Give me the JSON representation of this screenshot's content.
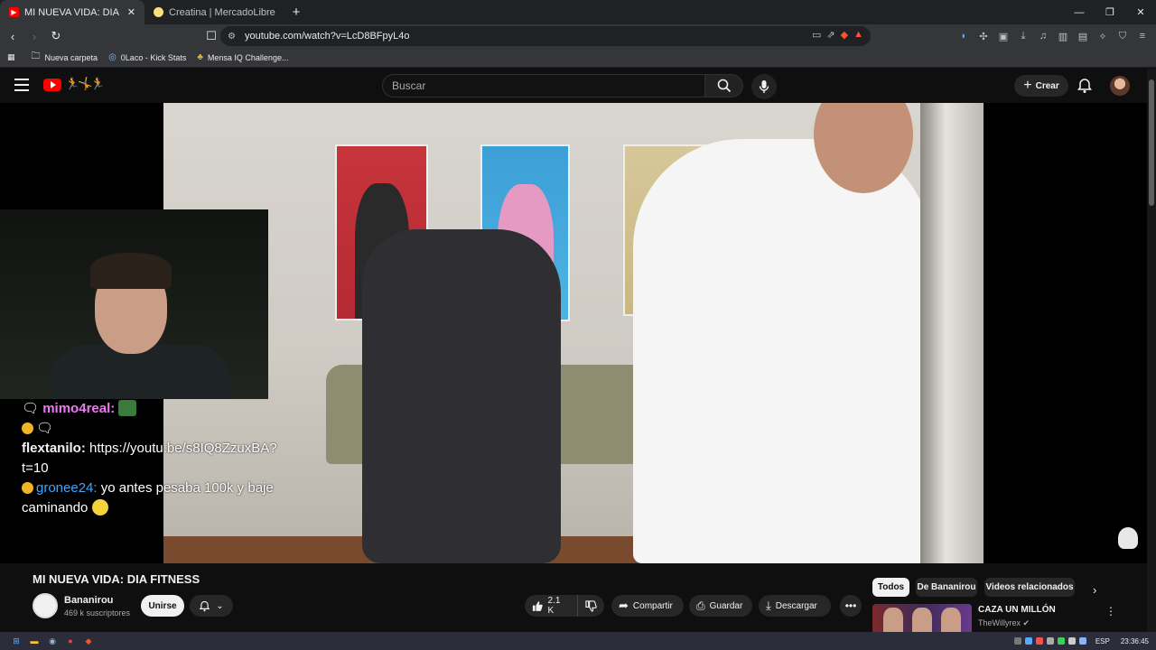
{
  "browser": {
    "tabs": [
      {
        "title": "MI NUEVA VIDA: DIA FITNESS - ",
        "active": true
      },
      {
        "title": "Creatina | MercadoLibre 📖",
        "active": false
      }
    ],
    "url": "youtube.com/watch?v=LcD8BFpyL4o",
    "bookmarks": [
      "Nueva carpeta",
      "0Laco - Kick Stats",
      "Mensa IQ Challenge..."
    ]
  },
  "header": {
    "search_placeholder": "Buscar",
    "create_label": "Crear",
    "doodle": "🏃🤸🏃"
  },
  "chat": {
    "lines": [
      {
        "user": "mimo4real:",
        "text": ""
      },
      {
        "user": "flextanilo:",
        "text": "https://youtu.be/s8IQ8ZzuxBA?t=10"
      },
      {
        "user": "gronee24:",
        "text": "yo antes pesaba 100k y baje caminando"
      }
    ]
  },
  "video": {
    "title": "MI NUEVA VIDA: DIA FITNESS",
    "channel": "Bananirou",
    "subscribers": "469 k suscriptores",
    "subscribe_label": "Unirse",
    "likes": "2.1 K",
    "share_label": "Compartir",
    "save_label": "Guardar",
    "download_label": "Descargar"
  },
  "chips": [
    "Todos",
    "De Bananirou",
    "Videos relacionados"
  ],
  "related": [
    {
      "title": "CAZA UN MILLÓN",
      "channel": "TheWillyrex"
    }
  ],
  "taskbar": {
    "lang": "ESP",
    "time": "23:36:45"
  },
  "colors": {
    "accent": "#ff0000",
    "link": "#3ea6ff"
  }
}
